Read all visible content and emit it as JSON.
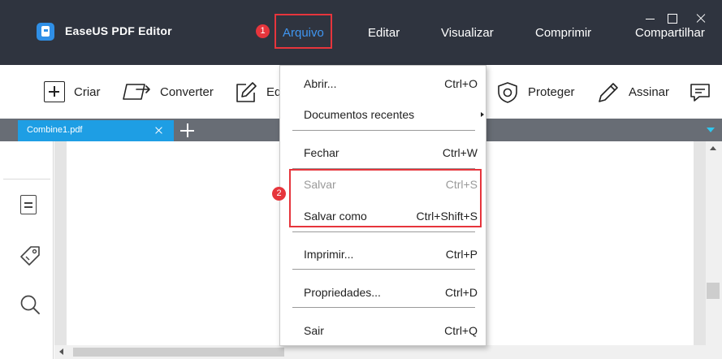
{
  "window": {
    "app_title": "EaseUS PDF Editor",
    "logo_icon": "easeus-pdf-logo-icon"
  },
  "menubar": {
    "items": [
      {
        "label": "Arquivo",
        "active": true
      },
      {
        "label": "Editar"
      },
      {
        "label": "Visualizar"
      },
      {
        "label": "Comprimir"
      },
      {
        "label": "Compartilhar"
      }
    ]
  },
  "toolbar": {
    "items": [
      {
        "label": "Criar",
        "icon": "plus-square-icon"
      },
      {
        "label": "Converter",
        "icon": "convert-icon"
      },
      {
        "label": "Ed",
        "icon": "edit-icon"
      },
      {
        "label": "Proteger",
        "icon": "shield-icon"
      },
      {
        "label": "Assinar",
        "icon": "pen-icon"
      },
      {
        "icon": "comment-icon"
      }
    ]
  },
  "tabs": {
    "items": [
      {
        "label": "Combine1.pdf",
        "active": true
      }
    ],
    "accent_color": "#1e9ee4"
  },
  "sidebar": {
    "icons": [
      "pages-icon",
      "tag-icon",
      "search-icon"
    ]
  },
  "file_menu": {
    "items": [
      {
        "label": "Abrir...",
        "shortcut": "Ctrl+O"
      },
      {
        "label": "Documentos recentes",
        "submenu": true
      },
      {
        "label": "Fechar",
        "shortcut": "Ctrl+W"
      },
      {
        "label": "Salvar",
        "shortcut": "Ctrl+S",
        "disabled": true
      },
      {
        "label": "Salvar como",
        "shortcut": "Ctrl+Shift+S"
      },
      {
        "label": "Imprimir...",
        "shortcut": "Ctrl+P"
      },
      {
        "label": "Propriedades...",
        "shortcut": "Ctrl+D"
      },
      {
        "label": "Sair",
        "shortcut": "Ctrl+Q"
      }
    ]
  },
  "annotations": {
    "steps": [
      "1",
      "2"
    ],
    "highlight_color": "#e6353c"
  }
}
